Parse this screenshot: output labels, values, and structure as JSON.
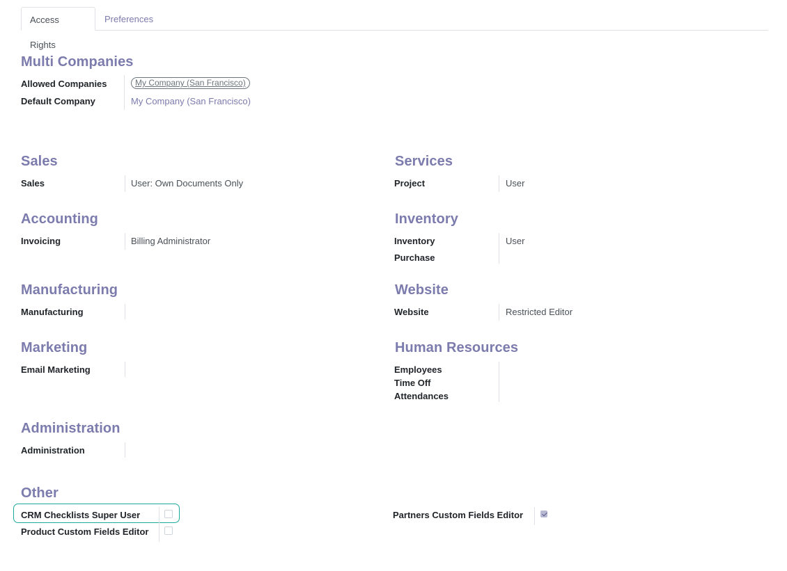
{
  "tabs": [
    {
      "label": "Access Rights",
      "active": true
    },
    {
      "label": "Preferences",
      "active": false
    }
  ],
  "multi_companies": {
    "title": "Multi Companies",
    "allowed_label": "Allowed Companies",
    "allowed_value": "My Company (San Francisco)",
    "default_label": "Default Company",
    "default_value": "My Company (San Francisco)"
  },
  "sales": {
    "title": "Sales",
    "field_label": "Sales",
    "field_value": "User: Own Documents Only"
  },
  "services": {
    "title": "Services",
    "field_label": "Project",
    "field_value": "User"
  },
  "accounting": {
    "title": "Accounting",
    "field_label": "Invoicing",
    "field_value": "Billing Administrator"
  },
  "inventory": {
    "title": "Inventory",
    "field1_label": "Inventory",
    "field1_value": "User",
    "field2_label": "Purchase",
    "field2_value": ""
  },
  "manufacturing": {
    "title": "Manufacturing",
    "field_label": "Manufacturing",
    "field_value": ""
  },
  "website": {
    "title": "Website",
    "field_label": "Website",
    "field_value": "Restricted Editor"
  },
  "marketing": {
    "title": "Marketing",
    "field_label": "Email Marketing",
    "field_value": ""
  },
  "human_resources": {
    "title": "Human Resources",
    "labels": [
      "Employees",
      "Time Off",
      "Attendances"
    ]
  },
  "administration": {
    "title": "Administration",
    "field_label": "Administration",
    "field_value": ""
  },
  "other": {
    "title": "Other",
    "crm_label": "CRM Checklists Super User",
    "crm_checked": false,
    "product_label": "Product Custom Fields Editor",
    "product_checked": false,
    "partners_label": "Partners Custom Fields Editor",
    "partners_checked": true
  },
  "colors": {
    "accent": "#7c7bad",
    "highlight": "#1aab9b"
  }
}
